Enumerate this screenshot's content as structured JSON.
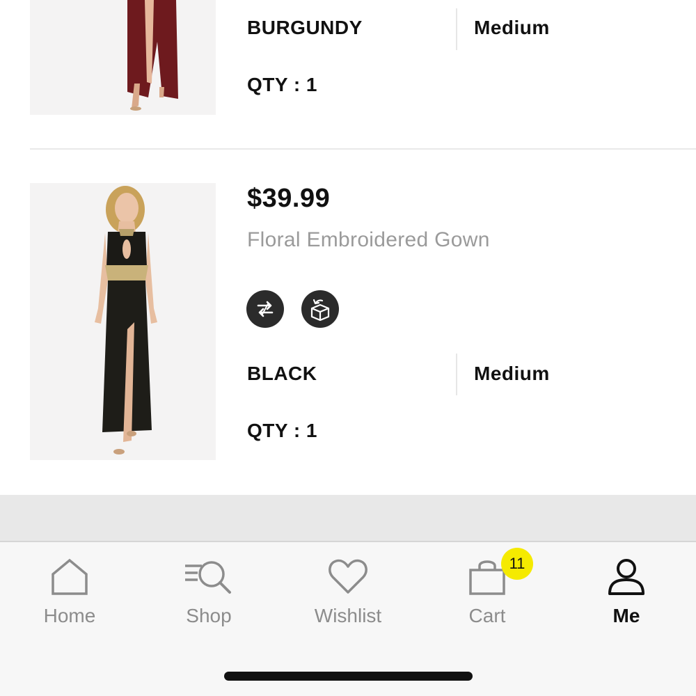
{
  "items": [
    {
      "color": "BURGUNDY",
      "size": "Medium",
      "qty": "QTY : 1"
    },
    {
      "price": "$39.99",
      "name": "Floral Embroidered Gown",
      "color": "BLACK",
      "size": "Medium",
      "qty": "QTY : 1",
      "action_icons": [
        "exchange-icon",
        "return-box-icon"
      ]
    }
  ],
  "tabs": [
    {
      "label": "Home",
      "icon": "home-icon"
    },
    {
      "label": "Shop",
      "icon": "shop-search-icon"
    },
    {
      "label": "Wishlist",
      "icon": "heart-icon"
    },
    {
      "label": "Cart",
      "icon": "bag-icon",
      "badge": "11"
    },
    {
      "label": "Me",
      "icon": "person-icon",
      "active": true
    }
  ],
  "colors": {
    "badge": "#f5ea00",
    "text": "#111111",
    "muted": "#9a9a9a"
  }
}
